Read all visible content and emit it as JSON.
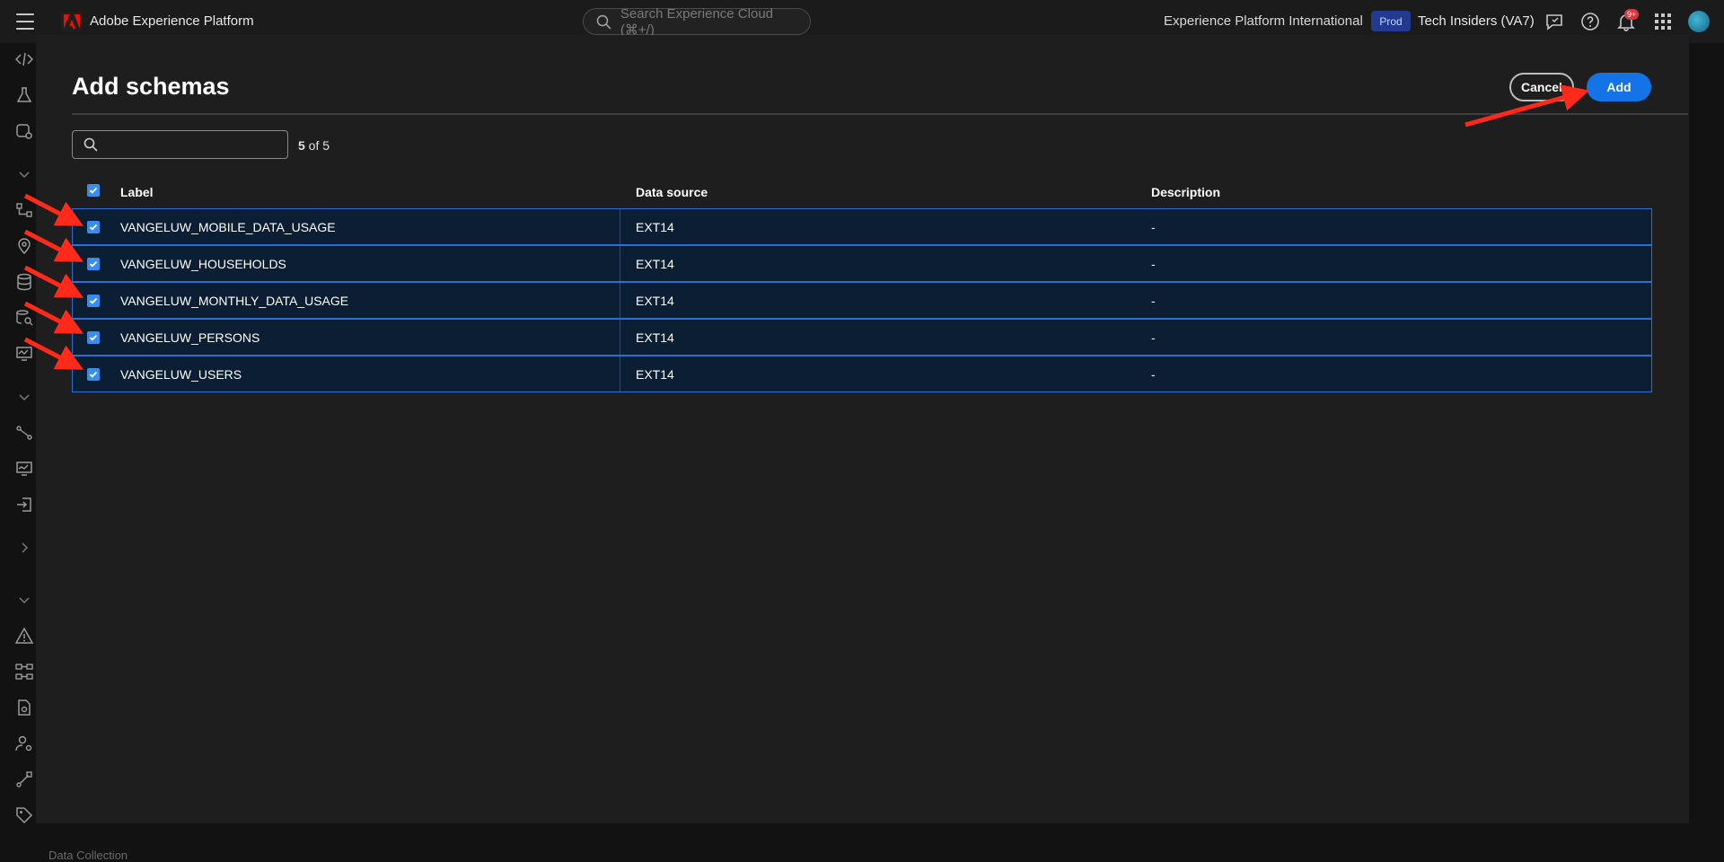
{
  "topbar": {
    "app_title": "Adobe Experience Platform",
    "search_placeholder": "Search Experience Cloud (⌘+/)",
    "org_name": "Experience Platform International",
    "env_badge": "Prod",
    "sandbox_name": "Tech Insiders (VA7)",
    "notification_count": "9+",
    "icons": [
      "menu-icon",
      "adobe-logo-icon",
      "search-icon",
      "feedback-icon",
      "help-icon",
      "bell-icon",
      "apps-grid-icon",
      "avatar"
    ]
  },
  "rail": {
    "icons": [
      "code-icon",
      "flask-icon",
      "schema-settings-icon",
      "chevron-down-icon",
      "workflow-icon",
      "location-icon",
      "database-icon",
      "query-icon",
      "monitor-icon",
      "chevron-down-icon",
      "path-icon",
      "dashboard-icon",
      "import-icon",
      "chevron-right-icon",
      "chevron-down-icon",
      "alert-icon",
      "graph-icon",
      "document-settings-icon",
      "user-settings-icon",
      "pipeline-icon",
      "tag-icon"
    ]
  },
  "behind": {
    "section_label": "Data Collection"
  },
  "modal": {
    "title": "Add schemas",
    "cancel_label": "Cancel",
    "add_label": "Add",
    "search_value": "",
    "count_shown": "5",
    "count_rest": " of 5",
    "columns": {
      "label": "Label",
      "data_source": "Data source",
      "description": "Description"
    },
    "rows": [
      {
        "label": "VANGELUW_MOBILE_DATA_USAGE",
        "data_source": "EXT14",
        "description": "-",
        "checked": true
      },
      {
        "label": "VANGELUW_HOUSEHOLDS",
        "data_source": "EXT14",
        "description": "-",
        "checked": true
      },
      {
        "label": "VANGELUW_MONTHLY_DATA_USAGE",
        "data_source": "EXT14",
        "description": "-",
        "checked": true
      },
      {
        "label": "VANGELUW_PERSONS",
        "data_source": "EXT14",
        "description": "-",
        "checked": true
      },
      {
        "label": "VANGELUW_USERS",
        "data_source": "EXT14",
        "description": "-",
        "checked": true
      }
    ]
  },
  "colors": {
    "accent": "#1473e6",
    "checkbox": "#378ef0",
    "selected_row": "#0b1e33",
    "annotation_arrow": "#ff2a1a"
  }
}
